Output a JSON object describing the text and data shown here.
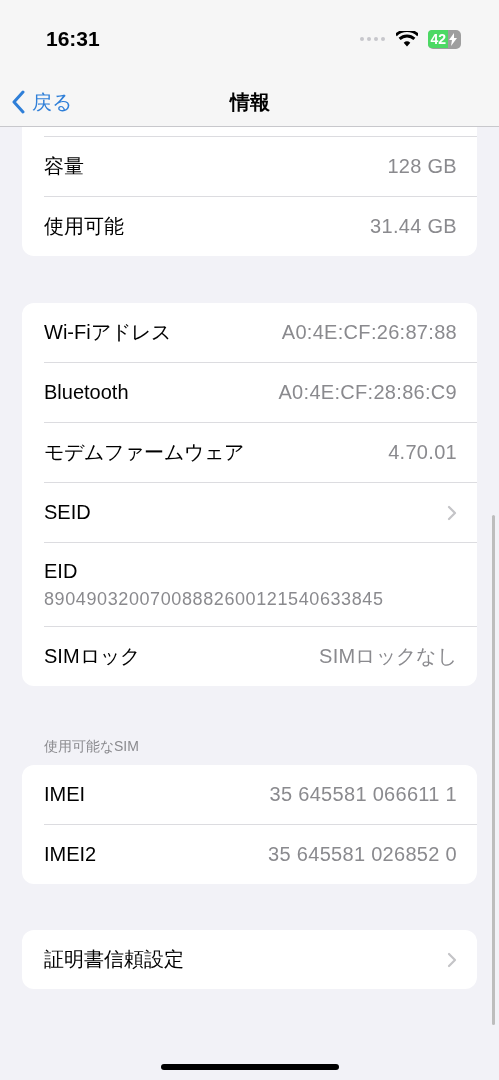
{
  "status_bar": {
    "time": "16:31",
    "battery": {
      "text": "42",
      "charging": true
    }
  },
  "nav": {
    "back": "戻る",
    "title": "情報"
  },
  "groups": [
    {
      "header_cut": true,
      "rows": [
        {
          "kind": "value",
          "label": "容量",
          "value": "128 GB"
        },
        {
          "kind": "value",
          "label": "使用可能",
          "value": "31.44 GB"
        }
      ]
    },
    {
      "rows": [
        {
          "kind": "value",
          "label": "Wi-Fiアドレス",
          "value": "A0:4E:CF:26:87:88"
        },
        {
          "kind": "value",
          "label": "Bluetooth",
          "value": "A0:4E:CF:28:86:C9"
        },
        {
          "kind": "value",
          "label": "モデムファームウェア",
          "value": "4.70.01"
        },
        {
          "kind": "chevron",
          "label": "SEID"
        },
        {
          "kind": "stacked",
          "label": "EID",
          "value": "89049032007008882600121540633845"
        },
        {
          "kind": "value",
          "label": "SIMロック",
          "value": "SIMロックなし"
        }
      ]
    },
    {
      "title": "使用可能なSIM",
      "rows": [
        {
          "kind": "value",
          "label": "IMEI",
          "value": "35 645581 066611 1"
        },
        {
          "kind": "value",
          "label": "IMEI2",
          "value": "35 645581 026852 0"
        }
      ]
    },
    {
      "rows": [
        {
          "kind": "chevron",
          "label": "証明書信頼設定"
        }
      ]
    }
  ]
}
